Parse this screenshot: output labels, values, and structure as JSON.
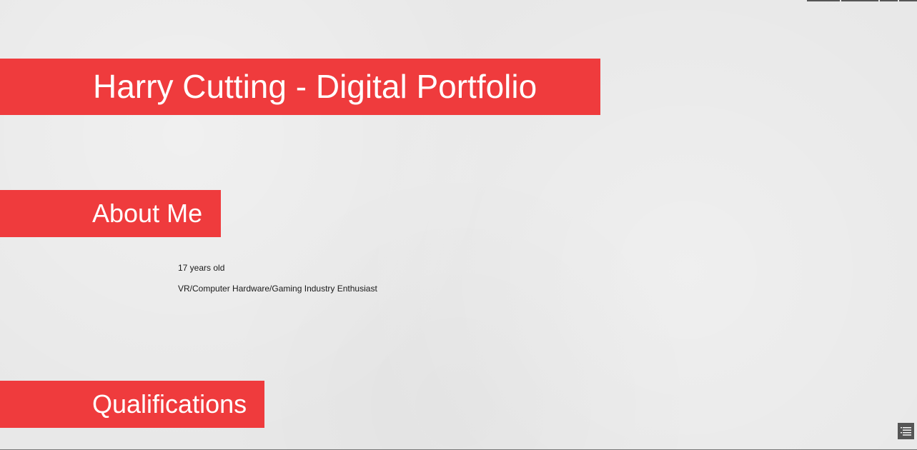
{
  "header": {
    "title": "Harry Cutting - Digital Portfolio"
  },
  "about": {
    "heading": "About Me",
    "items": [
      "17 years old",
      "VR/Computer Hardware/Gaming Industry Enthusiast"
    ]
  },
  "qualifications": {
    "heading": "Qualifications"
  },
  "controls": {
    "toc_icon": "list-menu-icon"
  },
  "colors": {
    "accent": "#ef3b3d",
    "background": "#e8e8e8",
    "control": "#555555"
  }
}
